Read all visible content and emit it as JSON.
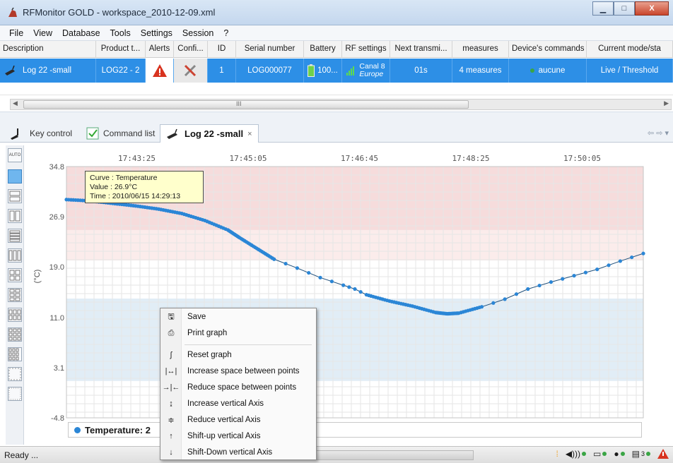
{
  "window": {
    "title": "RFMonitor GOLD - workspace_2010-12-09.xml"
  },
  "menu": [
    "File",
    "View",
    "Database",
    "Tools",
    "Settings",
    "Session",
    "?"
  ],
  "grid": {
    "columns": [
      "Description",
      "Product t...",
      "Alerts",
      "Confi...",
      "ID",
      "Serial number",
      "Battery",
      "RF settings",
      "Next transmi...",
      "measures",
      "Device's commands",
      "Current mode/sta"
    ],
    "row": {
      "description": "Log 22 -small",
      "product": "LOG22 - 2",
      "id": "1",
      "serial": "LOG000077",
      "battery": "100...",
      "rf_channel": "Canal 8",
      "rf_region": "Europe",
      "next_transmission": "01s",
      "measures": "4 measures",
      "commands": "aucune",
      "mode": "Live / Threshold"
    },
    "scroll_mark": "III"
  },
  "tabs": {
    "key_control": "Key control",
    "command_list": "Command list",
    "log_tab": "Log 22 -small",
    "close": "×"
  },
  "toolbar": {
    "auto": "AUTO"
  },
  "chart_data": {
    "type": "line",
    "title": "",
    "xlabel": "",
    "ylabel": "(°C)",
    "x_ticks": [
      "17:43:25",
      "17:45:05",
      "17:46:45",
      "17:48:25",
      "17:50:05"
    ],
    "y_ticks": [
      "34.8",
      "26.9",
      "19.0",
      "11.0",
      "3.1",
      "-4.8"
    ],
    "ylim": [
      -4.8,
      34.8
    ],
    "grid": true,
    "threshold_bands": [
      {
        "from": 24.8,
        "to": 34.8,
        "color": "#f6dcdc"
      },
      {
        "from": 20.0,
        "to": 24.8,
        "color": "#fbeceb"
      },
      {
        "from": 14.0,
        "to": 20.0,
        "color": "#ffffff"
      },
      {
        "from": 1.0,
        "to": 14.0,
        "color": "#e1edf6"
      },
      {
        "from": -4.8,
        "to": 1.0,
        "color": "#ffffff"
      }
    ],
    "series": [
      {
        "name": "Temperature",
        "color": "#2b86d6",
        "points": [
          [
            0.0,
            29.6
          ],
          [
            0.04,
            29.4
          ],
          [
            0.08,
            29.0
          ],
          [
            0.12,
            28.6
          ],
          [
            0.16,
            28.1
          ],
          [
            0.2,
            27.4
          ],
          [
            0.24,
            26.3
          ],
          [
            0.28,
            24.8
          ],
          [
            0.3,
            23.6
          ],
          [
            0.33,
            21.9
          ],
          [
            0.36,
            20.2
          ],
          [
            0.4,
            18.8
          ],
          [
            0.44,
            17.3
          ],
          [
            0.48,
            16.1
          ],
          [
            0.5,
            15.5
          ],
          [
            0.52,
            14.6
          ],
          [
            0.56,
            13.6
          ],
          [
            0.6,
            12.8
          ],
          [
            0.64,
            11.8
          ],
          [
            0.66,
            11.6
          ],
          [
            0.68,
            11.7
          ],
          [
            0.72,
            12.7
          ],
          [
            0.76,
            13.9
          ],
          [
            0.8,
            15.5
          ],
          [
            0.84,
            16.6
          ],
          [
            0.88,
            17.6
          ],
          [
            0.92,
            18.6
          ],
          [
            0.96,
            19.9
          ],
          [
            1.0,
            21.1
          ]
        ]
      }
    ],
    "legend": "Temperature:  2",
    "tooltip": {
      "curve": "Curve : Temperature",
      "value": "Value : 26.9°C",
      "time": "Time : 2010/06/15 14:29:13"
    }
  },
  "context_menu": {
    "items": [
      "Save",
      "Print graph",
      "Reset graph",
      "Increase space between points",
      "Reduce space between points",
      "Increase vertical Axis",
      "Reduce vertical Axis",
      "Shift-up vertical Axis",
      "Shift-Down vertical Axis"
    ],
    "icons": [
      "save-icon",
      "print-icon",
      "reset-icon",
      "widen-icon",
      "narrow-icon",
      "v-increase-icon",
      "v-reduce-icon",
      "arrow-up-icon",
      "arrow-down-icon"
    ]
  },
  "status": {
    "text": "Ready ...",
    "icon3_count": "3"
  },
  "colors": {
    "accent": "#2d8fe6",
    "series": "#2b86d6"
  }
}
